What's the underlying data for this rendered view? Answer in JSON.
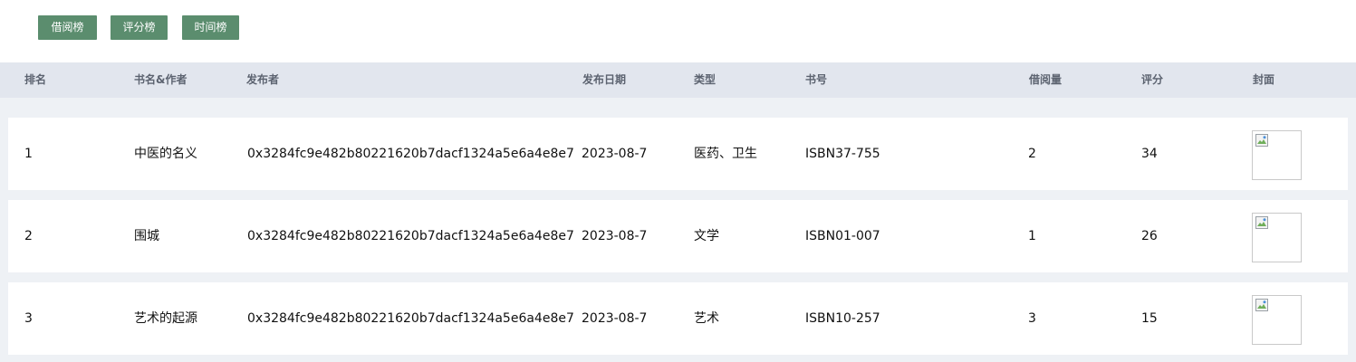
{
  "tabs": [
    "借阅榜",
    "评分榜",
    "时间榜"
  ],
  "table": {
    "headers": {
      "rank": "排名",
      "title_author": "书名&作者",
      "publisher": "发布者",
      "date": "发布日期",
      "type": "类型",
      "isbn": "书号",
      "borrows": "借阅量",
      "score": "评分",
      "cover": "封面"
    },
    "rows": [
      {
        "rank": "1",
        "title": "中医的名义",
        "publisher": "0x3284fc9e482b80221620b7dacf1324a5e6a4e8e7",
        "date": "2023-08-7",
        "type": "医药、卫生",
        "isbn": "ISBN37-755",
        "borrows": "2",
        "score": "34",
        "cover_icon": "broken-image-icon"
      },
      {
        "rank": "2",
        "title": "围城",
        "publisher": "0x3284fc9e482b80221620b7dacf1324a5e6a4e8e7",
        "date": "2023-08-7",
        "type": "文学",
        "isbn": "ISBN01-007",
        "borrows": "1",
        "score": "26",
        "cover_icon": "broken-image-icon"
      },
      {
        "rank": "3",
        "title": "艺术的起源",
        "publisher": "0x3284fc9e482b80221620b7dacf1324a5e6a4e8e7",
        "date": "2023-08-7",
        "type": "艺术",
        "isbn": "ISBN10-257",
        "borrows": "3",
        "score": "15",
        "cover_icon": "broken-image-icon"
      }
    ]
  },
  "colors": {
    "tab_bg": "#5b8d6e",
    "header_bg": "#e2e6ee",
    "page_bg": "#eef1f5"
  }
}
